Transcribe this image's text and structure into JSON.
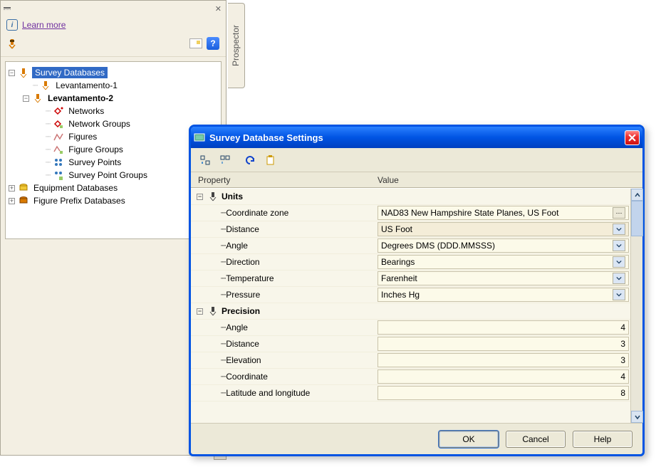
{
  "panel": {
    "learn_more": "Learn more",
    "side_tab": "Prospector"
  },
  "tree": {
    "root": "Survey Databases",
    "lev1": "Levantamento-1",
    "lev2": "Levantamento-2",
    "networks": "Networks",
    "network_groups": "Network Groups",
    "figures": "Figures",
    "figure_groups": "Figure Groups",
    "survey_points": "Survey Points",
    "survey_point_groups": "Survey Point Groups",
    "equip": "Equipment Databases",
    "figprefix": "Figure Prefix Databases"
  },
  "dialog": {
    "title": "Survey Database Settings",
    "headers": {
      "property": "Property",
      "value": "Value"
    },
    "groups": {
      "units": "Units",
      "precision": "Precision"
    },
    "props": {
      "coord_zone": "Coordinate zone",
      "distance": "Distance",
      "angle": "Angle",
      "direction": "Direction",
      "temperature": "Temperature",
      "pressure": "Pressure",
      "p_angle": "Angle",
      "p_distance": "Distance",
      "p_elevation": "Elevation",
      "p_coordinate": "Coordinate",
      "p_latlon": "Latitude and longitude"
    },
    "vals": {
      "coord_zone": "NAD83 New Hampshire State Planes, US Foot",
      "distance": "US Foot",
      "angle": "Degrees DMS (DDD.MMSSS)",
      "direction": "Bearings",
      "temperature": "Farenheit",
      "pressure": "Inches Hg",
      "p_angle": "4",
      "p_distance": "3",
      "p_elevation": "3",
      "p_coordinate": "4",
      "p_latlon": "8"
    },
    "buttons": {
      "ok": "OK",
      "cancel": "Cancel",
      "help": "Help"
    }
  }
}
